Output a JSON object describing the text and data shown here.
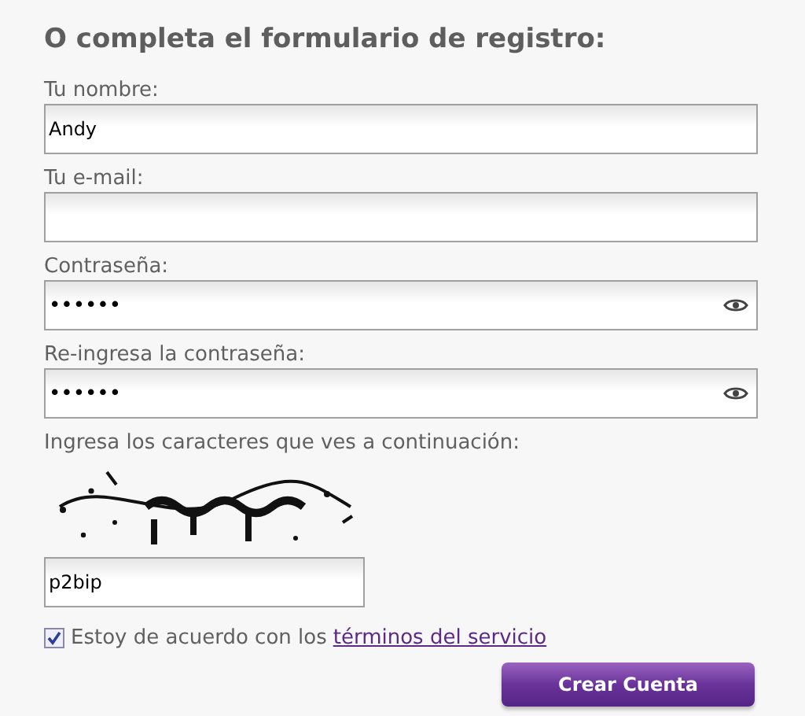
{
  "heading": "O completa el formulario de registro:",
  "fields": [
    {
      "kind": "text",
      "label": "Tu nombre:",
      "value": "Andy"
    },
    {
      "kind": "text",
      "label": "Tu e-mail:"
    },
    {
      "kind": "password",
      "label": "Contraseña:",
      "value": "••••••"
    },
    {
      "kind": "password",
      "label": "Re-ingresa la contraseña:",
      "value": "••••••"
    }
  ],
  "captcha": {
    "label": "Ingresa los caracteres que ves a continuación:",
    "value": "p2bip"
  },
  "agreement": {
    "checked": true,
    "text": "Estoy de acuerdo con los",
    "link": "términos del servicio"
  },
  "submit_button": "Crear Cuenta"
}
